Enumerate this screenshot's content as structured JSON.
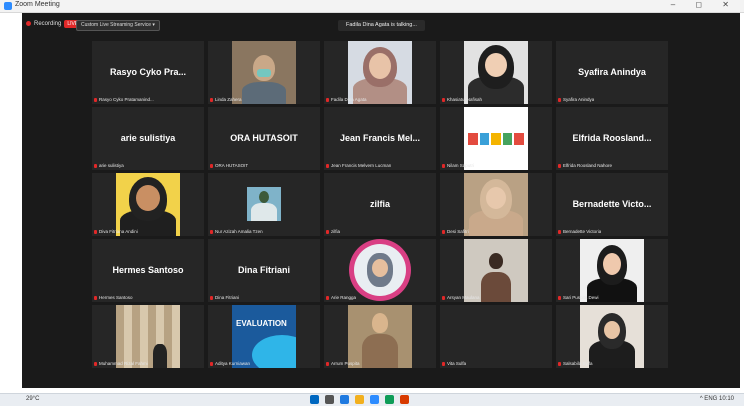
{
  "window": {
    "title": "Zoom Meeting",
    "controls": "– ◻ ✕"
  },
  "topbar": {
    "recording_label": "Recording",
    "live_label": "LIVE",
    "view_button": "Custom Live Streaming Service ▾",
    "speaking_text": "Fadila Dina Agata is talking..."
  },
  "tiles": [
    {
      "big": "Rasyo Cyko Pra...",
      "label": "Rasyo Cyko Pratamanind..."
    },
    {
      "big": "",
      "label": "Linda Zahera"
    },
    {
      "big": "",
      "label": "Fadila Dina Agata"
    },
    {
      "big": "",
      "label": "Khasiatul Nafisah"
    },
    {
      "big": "Syafira Anindya",
      "label": "Syafira Anindya"
    },
    {
      "big": "arie sulistiya",
      "label": "arie sulistiya"
    },
    {
      "big": "ORA HUTASOIT",
      "label": "ORA HUTASOIT"
    },
    {
      "big": "Jean Francis Mel...",
      "label": "Jean Francis Melvern Lucman"
    },
    {
      "big": "",
      "label": "Nilam Saputri"
    },
    {
      "big": "Elfrida Roosland...",
      "label": "Elfrida Roosland Nahore"
    },
    {
      "big": "",
      "label": "Diva Fitriana Andini"
    },
    {
      "big": "",
      "label": "Nur Azizah Amalia Tzen"
    },
    {
      "big": "zilfia",
      "label": "zilfia"
    },
    {
      "big": "",
      "label": "Desi Safitri"
    },
    {
      "big": "Bernadette Victo...",
      "label": "Bernadette Victoria"
    },
    {
      "big": "Hermes Santoso",
      "label": "Hermes Santoso"
    },
    {
      "big": "Dina Fitriani",
      "label": "Dina Fitriani"
    },
    {
      "big": "",
      "label": "Arie Rangga"
    },
    {
      "big": "",
      "label": "Arsyan Maulana"
    },
    {
      "big": "",
      "label": "Sari Puspita Dewi"
    },
    {
      "big": "",
      "label": "Muhammad Rizal Fahmi"
    },
    {
      "big": "",
      "label": "Aditya Kurniawan"
    },
    {
      "big": "",
      "label": "Arrum Puspita"
    },
    {
      "big": "",
      "label": "Vita Sulfa"
    },
    {
      "big": "",
      "label": "Salsabila Syifa"
    }
  ],
  "taskbar": {
    "weather": "29°C",
    "tray": "^ ENG 10:10"
  }
}
